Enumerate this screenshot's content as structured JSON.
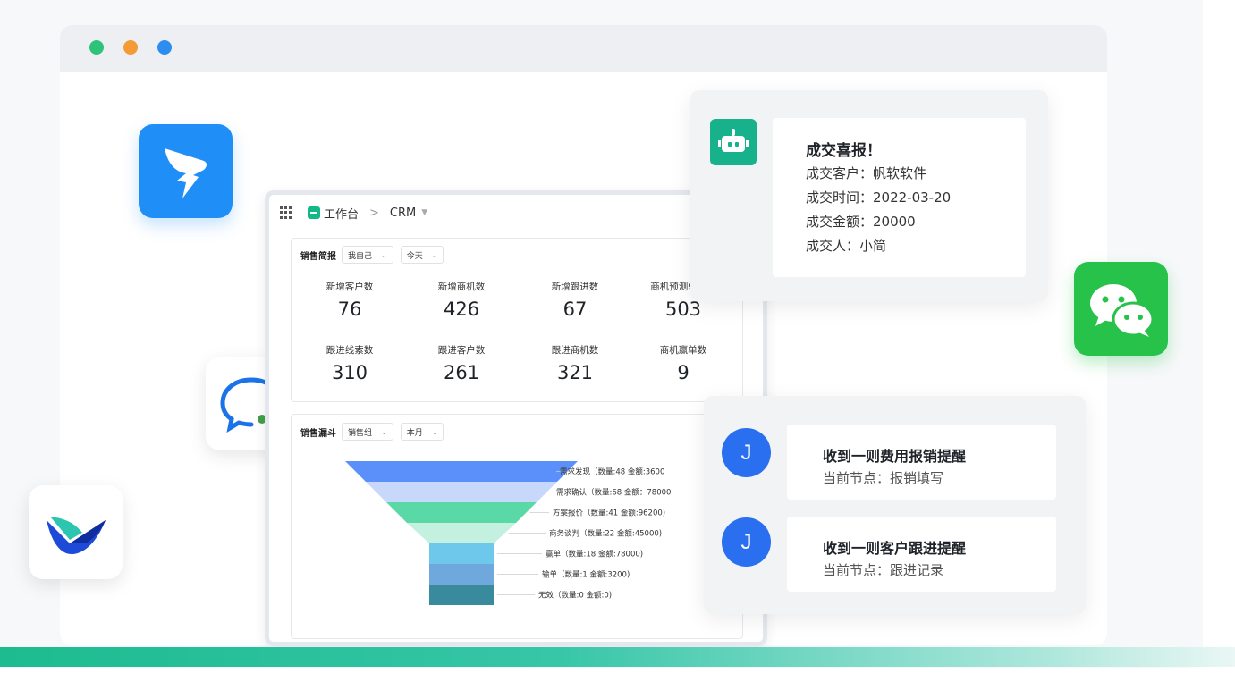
{
  "window": {
    "traffic_lights": [
      "green",
      "orange",
      "blue"
    ]
  },
  "icons": {
    "dingtalk": "dingtalk-logo-icon",
    "wecom": "wecom-logo-icon",
    "feishu": "feishu-logo-icon",
    "wechat": "wechat-logo-icon",
    "robot": "robot-icon"
  },
  "dashboard": {
    "breadcrumb": {
      "workspace": "工作台",
      "separator": ">",
      "app": "CRM",
      "caret": "▼"
    },
    "sales_brief": {
      "title": "销售简报",
      "filter_scope": "我自己",
      "filter_period": "今天",
      "caret": "⌄",
      "metrics": [
        {
          "label": "新增客户数",
          "value": "76"
        },
        {
          "label": "新增商机数",
          "value": "426"
        },
        {
          "label": "新增跟进数",
          "value": "67"
        },
        {
          "label": "商机预测总金额",
          "value": "503"
        },
        {
          "label": "跟进线索数",
          "value": "310"
        },
        {
          "label": "跟进客户数",
          "value": "261"
        },
        {
          "label": "跟进商机数",
          "value": "321"
        },
        {
          "label": "商机赢单数",
          "value": "9"
        }
      ]
    },
    "sales_funnel": {
      "title": "销售漏斗",
      "filter_scope": "销售组",
      "filter_period": "本月",
      "caret": "⌄",
      "stages": [
        {
          "label": "需求发现（数量:48  金额:3600",
          "color": "#5b8ff9"
        },
        {
          "label": "需求确认（数量:68  金额：78000",
          "color": "#c7d8fb"
        },
        {
          "label": "方案报价（数量:41  金额:96200)",
          "color": "#5ad8a6"
        },
        {
          "label": "商务谈判（数量:22  金额:45000)",
          "color": "#c3f0df"
        },
        {
          "label": "赢单（数量:18  金额:78000)",
          "color": "#6dc8ec"
        },
        {
          "label": "输单（数量:1  金额:3200)",
          "color": "#6fa8dc"
        },
        {
          "label": "无效（数量:0  金额:0)",
          "color": "#3a8a9e"
        }
      ]
    }
  },
  "deal_notice": {
    "title": "成交喜报！",
    "lines": [
      "成交客户：帆软软件",
      "成交时间：2022-03-20",
      "成交金额：20000",
      "成交人：小简"
    ]
  },
  "reminders": [
    {
      "avatar": "J",
      "title": "收到一则费用报销提醒",
      "subtitle": "当前节点：报销填写"
    },
    {
      "avatar": "J",
      "title": "收到一则客户跟进提醒",
      "subtitle": "当前节点：跟进记录"
    }
  ]
}
